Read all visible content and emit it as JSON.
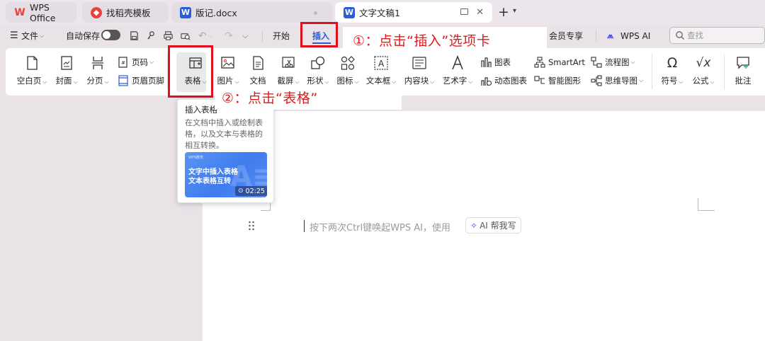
{
  "tabs": [
    {
      "label": "WPS Office",
      "icon": "wps-logo-icon"
    },
    {
      "label": "找稻壳模板",
      "icon": "docer-icon"
    },
    {
      "label": "版记.docx",
      "icon": "word-doc-icon"
    },
    {
      "label": "文字文稿1",
      "icon": "word-doc-icon",
      "active": true
    }
  ],
  "menubar": {
    "file_label": "文件",
    "autosave_label": "自动保存",
    "tabs": [
      "开始",
      "插入"
    ],
    "active_tab": "插入",
    "member_label": "会员专享",
    "wps_ai_label": "WPS AI",
    "search_placeholder": "查找"
  },
  "ribbon": {
    "blank_page": "空白页",
    "cover": "封面",
    "page_break": "分页",
    "page_number": "页码",
    "header_footer": "页眉页脚",
    "table": "表格",
    "picture": "图片",
    "doc": "文档",
    "screenshot": "截屏",
    "shape": "形状",
    "icons": "图标",
    "textbox": "文本框",
    "content_block": "内容块",
    "wordart": "艺术字",
    "chart": "图表",
    "dynamic_chart": "动态图表",
    "smartart": "SmartArt",
    "smart_graphic": "智能图形",
    "flowchart": "流程图",
    "mindmap": "思维导图",
    "symbol": "符号",
    "formula": "公式",
    "comment": "批注"
  },
  "annotations": {
    "step1": "①：点击“插入”选项卡",
    "step2": "②：点击“表格”"
  },
  "tooltip": {
    "title": "插入表格",
    "description": "在文档中插入或绘制表格，以及文本与表格的相互转换。",
    "video_tag": "WPS教育",
    "video_line1": "文字中插入表格",
    "video_line2": "文本表格互转",
    "duration": "02:25"
  },
  "document": {
    "hint": "按下两次Ctrl键唤起WPS AI，使用",
    "ai_button": "AI 帮我写"
  },
  "colors": {
    "accent_blue": "#2b5dd6",
    "annotation_red": "#e11a1a",
    "wps_red": "#e8413b"
  }
}
